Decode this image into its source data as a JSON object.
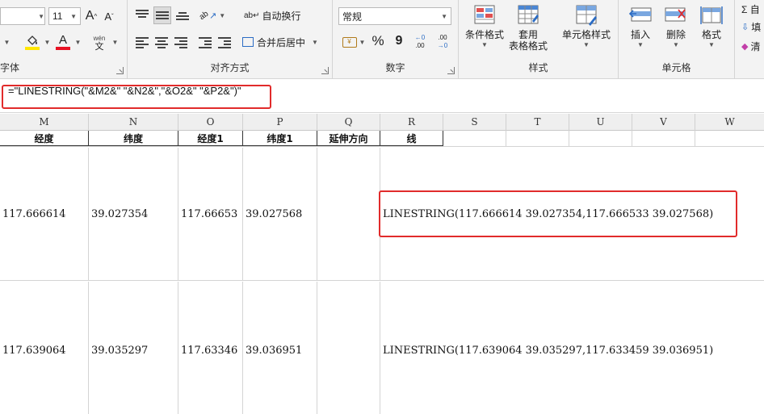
{
  "ribbon": {
    "font_group": {
      "label": "字体",
      "font_size": "11",
      "grow_font": "A",
      "shrink_font": "A",
      "font_color_glyph": "A",
      "phonetic_top": "wén",
      "phonetic_bottom": "文"
    },
    "alignment_group": {
      "label": "对齐方式",
      "wrap_text": "自动换行",
      "merge_center": "合并后居中",
      "orientation_glyph": "ab"
    },
    "number_group": {
      "label": "数字",
      "format_value": "常规",
      "percent": "%",
      "comma": "9",
      "inc_decimal": ".00",
      "dec_decimal": ".00"
    },
    "styles_group": {
      "label": "样式",
      "conditional_format": "条件格式",
      "table_format_line1": "套用",
      "table_format_line2": "表格格式",
      "cell_styles": "单元格样式"
    },
    "cells_group": {
      "label": "单元格",
      "insert": "插入",
      "delete": "删除",
      "format": "格式"
    },
    "editing_group": {
      "item1": "Σ 自",
      "item2": "填",
      "item3": "清"
    }
  },
  "formula_bar": {
    "formula": "=\"LINESTRING(\"&M2&\" \"&N2&\",\"&O2&\" \"&P2&\")\""
  },
  "columns": [
    "M",
    "N",
    "O",
    "P",
    "Q",
    "R",
    "S",
    "T",
    "U",
    "V",
    "W"
  ],
  "header_row": {
    "M": "经度",
    "N": "纬度",
    "O": "经度1",
    "P": "纬度1",
    "Q": "延伸方向",
    "R": "线"
  },
  "rows": [
    {
      "M": "117.666614",
      "N": "39.027354",
      "O": "117.66653",
      "P": "39.027568",
      "Q": "",
      "R": "LINESTRING(117.666614 39.027354,117.666533 39.027568)"
    },
    {
      "M": "117.639064",
      "N": "39.035297",
      "O": "117.63346",
      "P": "39.036951",
      "Q": "",
      "R": "LINESTRING(117.639064 39.035297,117.633459 39.036951)"
    }
  ],
  "colors": {
    "highlight_red": "#e12b2b",
    "font_color_bar": "#e81123",
    "fill_color_bar": "#ffe600"
  }
}
